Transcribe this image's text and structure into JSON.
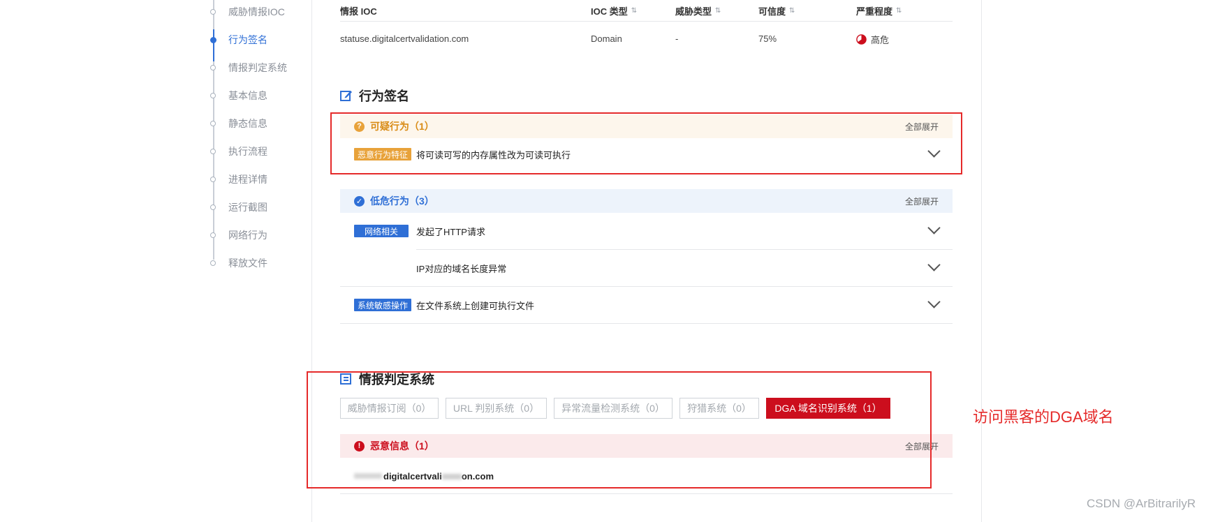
{
  "nav": {
    "items": [
      {
        "label": "威胁情报IOC",
        "active": false
      },
      {
        "label": "行为签名",
        "active": true
      },
      {
        "label": "情报判定系统",
        "active": false
      },
      {
        "label": "基本信息",
        "active": false
      },
      {
        "label": "静态信息",
        "active": false
      },
      {
        "label": "执行流程",
        "active": false
      },
      {
        "label": "进程详情",
        "active": false
      },
      {
        "label": "运行截图",
        "active": false
      },
      {
        "label": "网络行为",
        "active": false
      },
      {
        "label": "释放文件",
        "active": false
      }
    ]
  },
  "ioc_table": {
    "headers": [
      "情报 IOC",
      "IOC 类型",
      "威胁类型",
      "可信度",
      "严重程度"
    ],
    "sort_icon": "⇅",
    "row": {
      "ioc": "statuse.digitalcertvalidation.com",
      "type": "Domain",
      "threat": "-",
      "confidence": "75%",
      "severity": "高危"
    }
  },
  "behavior": {
    "title": "行为签名",
    "suspicious": {
      "title": "可疑行为（1）",
      "icon_glyph": "?",
      "expand": "全部展开",
      "items": [
        {
          "tag": "恶意行为特征",
          "text": "将可读可写的内存属性改为可读可执行"
        }
      ]
    },
    "low": {
      "title": "低危行为（3）",
      "icon_glyph": "✓",
      "expand": "全部展开",
      "items": [
        {
          "tag": "网络相关",
          "text": "发起了HTTP请求"
        },
        {
          "tag": "",
          "text": "IP对应的域名长度异常"
        },
        {
          "tag": "系统敏感操作",
          "text": "在文件系统上创建可执行文件"
        }
      ]
    }
  },
  "intel": {
    "title": "情报判定系统",
    "filters": [
      "威胁情报订阅（0）",
      "URL 判别系统（0）",
      "异常流量检测系统（0）",
      "狩猎系统（0）",
      "DGA 域名识别系统（1）"
    ],
    "active_filter": 4,
    "malicious": {
      "title": "恶意信息（1）",
      "icon_glyph": "!",
      "expand": "全部展开",
      "domain_visible": "digitalcertvali",
      "domain_tail": "on.com"
    }
  },
  "annotation": "访问黑客的DGA域名",
  "watermark": "CSDN @ArBitrarilyR",
  "colors": {
    "accent": "#2f6fd6",
    "danger": "#cc0e1d",
    "warning": "#e8a23a",
    "box": "#e52a2a"
  }
}
